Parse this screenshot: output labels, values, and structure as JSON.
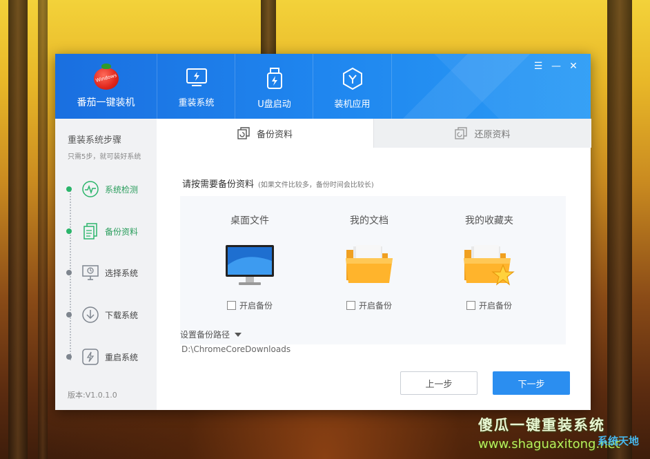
{
  "app": {
    "logo_badge": "Windows",
    "name": "番茄一键装机"
  },
  "nav": [
    {
      "label": "重装系统",
      "icon": "reinstall-monitor-icon"
    },
    {
      "label": "U盘启动",
      "icon": "usb-drive-icon"
    },
    {
      "label": "装机应用",
      "icon": "app-hexagon-icon"
    }
  ],
  "window_controls": {
    "menu": "☰",
    "minimize": "—",
    "close": "✕"
  },
  "sidebar": {
    "title": "重装系统步骤",
    "subtitle": "只需5步，就可装好系统",
    "steps": [
      {
        "label": "系统检测",
        "state": "done",
        "icon": "pulse-check-icon"
      },
      {
        "label": "备份资料",
        "state": "done",
        "icon": "document-copy-icon"
      },
      {
        "label": "选择系统",
        "state": "pending",
        "icon": "monitor-select-icon"
      },
      {
        "label": "下载系统",
        "state": "pending",
        "icon": "download-circle-icon"
      },
      {
        "label": "重启系统",
        "state": "pending",
        "icon": "restart-icon"
      }
    ],
    "version": "版本:V1.0.1.0"
  },
  "tabs": [
    {
      "label": "备份资料",
      "active": true
    },
    {
      "label": "还原资料",
      "active": false
    }
  ],
  "main": {
    "hint": "请按需要备份资料",
    "hint_note": "(如果文件比较多，备份时间会比较长)",
    "cards": [
      {
        "name": "桌面文件",
        "checkbox_label": "开启备份",
        "checked": false,
        "icon": "desktop-monitor-icon"
      },
      {
        "name": "我的文档",
        "checkbox_label": "开启备份",
        "checked": false,
        "icon": "folder-icon"
      },
      {
        "name": "我的收藏夹",
        "checkbox_label": "开启备份",
        "checked": false,
        "icon": "folder-star-icon"
      }
    ],
    "path_label": "设置备份路径",
    "path_value": "D:\\ChromeCoreDownloads",
    "prev_button": "上一步",
    "next_button": "下一步"
  },
  "watermark": {
    "title": "傻瓜一键重装系统",
    "url": "www.shaguaxitong.net",
    "badge": "系统天地"
  },
  "colors": {
    "brand_blue": "#1f86ef",
    "step_done": "#2bb56b",
    "next_button": "#2b8ef0"
  }
}
